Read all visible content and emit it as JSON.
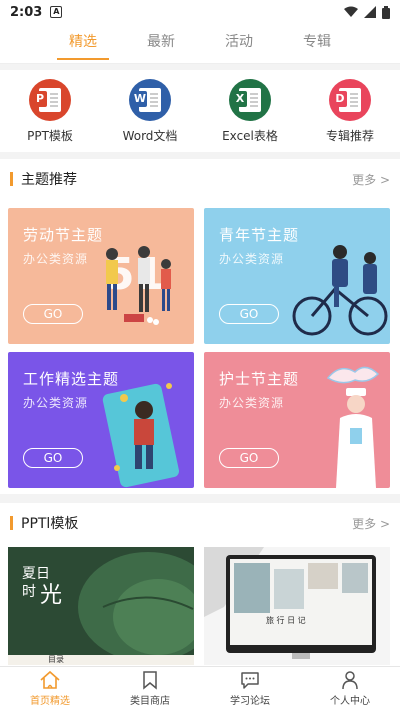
{
  "status": {
    "time": "2:03",
    "badge": "A"
  },
  "tabs": [
    {
      "label": "精选",
      "active": true
    },
    {
      "label": "最新",
      "active": false
    },
    {
      "label": "活动",
      "active": false
    },
    {
      "label": "专辑",
      "active": false
    }
  ],
  "categories": [
    {
      "label": "PPT模板",
      "icon": "ppt-icon",
      "color": "#d9462c",
      "letter": "P"
    },
    {
      "label": "Word文档",
      "icon": "word-icon",
      "color": "#2f5fa8",
      "letter": "W"
    },
    {
      "label": "Excel表格",
      "icon": "excel-icon",
      "color": "#217346",
      "letter": "X"
    },
    {
      "label": "专辑推荐",
      "icon": "album-icon",
      "color": "#e9455c",
      "letter": "D"
    }
  ],
  "themes": {
    "title": "主题推荐",
    "more": "更多 >",
    "cards": [
      {
        "title": "劳动节主题",
        "sub": "办公类资源",
        "go": "GO",
        "color": "#f6b99a"
      },
      {
        "title": "青年节主题",
        "sub": "办公类资源",
        "go": "GO",
        "color": "#8fd0ec"
      },
      {
        "title": "工作精选主题",
        "sub": "办公类资源",
        "go": "GO",
        "color": "#7a55e8"
      },
      {
        "title": "护士节主题",
        "sub": "办公类资源",
        "go": "GO",
        "color": "#ef8d98"
      }
    ]
  },
  "ppt": {
    "title": "PPTl模板",
    "more": "更多 >",
    "thumb1": {
      "line1": "夏日",
      "line2": "时",
      "line3": "光",
      "tag": "目录"
    },
    "thumb2": {
      "title": "旅 行 日 记"
    }
  },
  "nav": [
    {
      "label": "首页精选",
      "icon": "home-icon",
      "active": true
    },
    {
      "label": "类目商店",
      "icon": "bookmark-icon",
      "active": false
    },
    {
      "label": "学习论坛",
      "icon": "chat-icon",
      "active": false
    },
    {
      "label": "个人中心",
      "icon": "user-icon",
      "active": false
    }
  ],
  "colors": {
    "accent": "#f29a2e"
  }
}
